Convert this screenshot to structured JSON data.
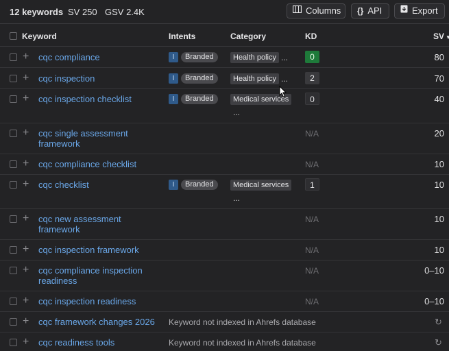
{
  "summary": {
    "keywords": "12 keywords",
    "sv": "SV 250",
    "gsv": "GSV 2.4K"
  },
  "toolbar": {
    "columns_label": "Columns",
    "api_label": "API",
    "export_label": "Export"
  },
  "header": {
    "keyword": "Keyword",
    "intents": "Intents",
    "category": "Category",
    "kd": "KD",
    "sv": "SV"
  },
  "rows": [
    {
      "keyword": "cqc compliance",
      "intent": "I",
      "intent_badge": "Branded",
      "category": "Health policy",
      "category_more": "...",
      "kd": "0",
      "sv": "80"
    },
    {
      "keyword": "cqc inspection",
      "intent": "I",
      "intent_badge": "Branded",
      "category": "Health policy",
      "category_more": "...",
      "kd": "2",
      "sv": "70"
    },
    {
      "keyword": "cqc inspection checklist",
      "intent": "I",
      "intent_badge": "Branded",
      "category": "Medical services",
      "category_more": "...",
      "kd": "0",
      "sv": "40"
    },
    {
      "keyword": "cqc single assessment framework",
      "kd": "N/A",
      "sv": "20"
    },
    {
      "keyword": "cqc compliance checklist",
      "kd": "N/A",
      "sv": "10"
    },
    {
      "keyword": "cqc checklist",
      "intent": "I",
      "intent_badge": "Branded",
      "category": "Medical services",
      "category_more": "...",
      "kd": "1",
      "sv": "10"
    },
    {
      "keyword": "cqc new assessment framework",
      "kd": "N/A",
      "sv": "10"
    },
    {
      "keyword": "cqc inspection framework",
      "kd": "N/A",
      "sv": "10"
    },
    {
      "keyword": "cqc compliance inspection readiness",
      "kd": "N/A",
      "sv": "0–10"
    },
    {
      "keyword": "cqc inspection readiness",
      "kd": "N/A",
      "sv": "0–10"
    },
    {
      "keyword": "cqc framework changes 2026",
      "note": "Keyword not indexed in Ahrefs database"
    },
    {
      "keyword": "cqc readiness tools",
      "note": "Keyword not indexed in Ahrefs database"
    }
  ],
  "colors": {
    "background": "#232325",
    "link": "#6aa7e8",
    "kd_easy": "#1e7a3a",
    "intent_informational": "#2f5a8a"
  },
  "icons": {
    "columns": "columns-icon",
    "api": "braces-icon",
    "export": "export-icon",
    "add": "plus-icon",
    "refresh": "refresh-icon",
    "sort": "sort-desc-icon"
  }
}
